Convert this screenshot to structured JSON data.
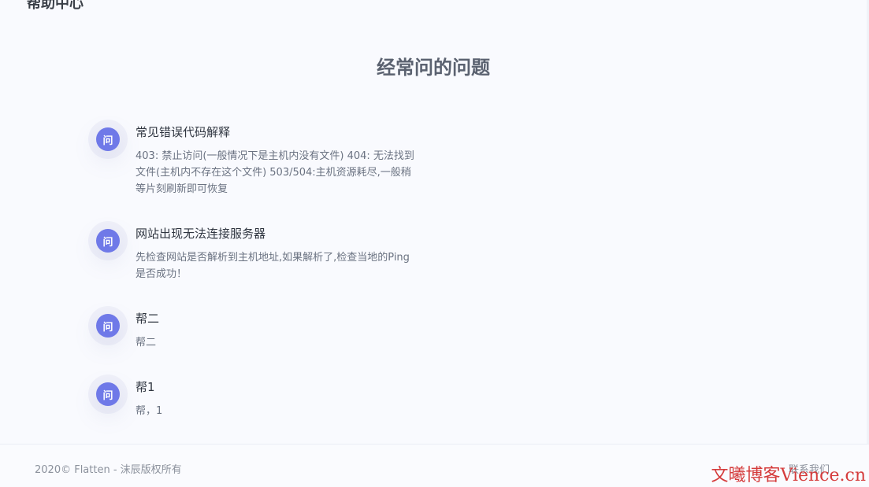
{
  "header": {
    "title": "帮助中心"
  },
  "page": {
    "title": "经常问的问题"
  },
  "faq": {
    "icon_text": "问",
    "items": [
      {
        "question": "常见错误代码解释",
        "answer": "403: 禁止访问(一般情况下是主机内没有文件) 404: 无法找到文件(主机内不存在这个文件) 503/504:主机资源耗尽,一般稍等片刻刷新即可恢复"
      },
      {
        "question": "网站出现无法连接服务器",
        "answer": "先检查网站是否解析到主机地址,如果解析了,检查当地的Ping是否成功！"
      },
      {
        "question": "帮二",
        "answer": "帮二"
      },
      {
        "question": "帮1",
        "answer": "帮，1"
      }
    ]
  },
  "footer": {
    "copyright": "2020© Flatten - 沫辰版权所有",
    "contact": "联系我们"
  },
  "watermark": {
    "text": "文曦博客Vience.cn"
  },
  "colors": {
    "accent": "#6f79e8",
    "background": "#f9fafe",
    "watermark": "#d53c3c"
  }
}
